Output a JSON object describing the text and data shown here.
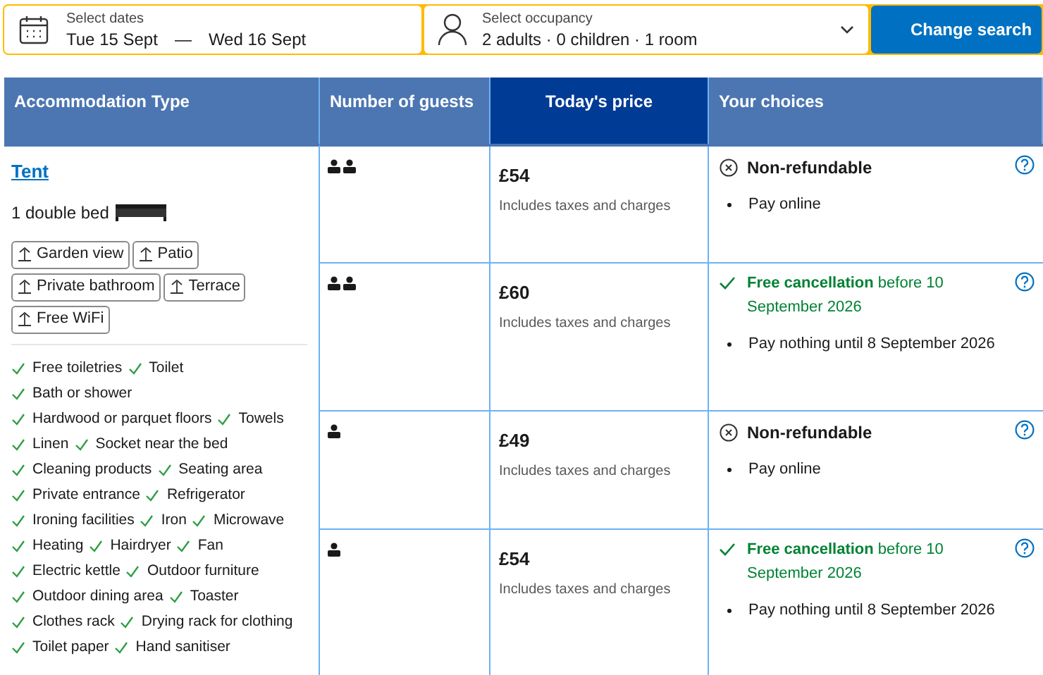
{
  "search_bar": {
    "dates": {
      "label": "Select dates",
      "check_in": "Tue 15 Sept",
      "separator": "—",
      "check_out": "Wed 16 Sept"
    },
    "occupancy": {
      "label": "Select occupancy",
      "value": "2 adults · 0 children · 1 room"
    },
    "button": "Change search"
  },
  "table": {
    "columns": [
      {
        "label": "Accommodation Type",
        "selected": false
      },
      {
        "label": "Number of guests",
        "selected": false
      },
      {
        "label": "Today's price",
        "selected": true
      },
      {
        "label": "Your choices",
        "selected": false
      }
    ],
    "accommodation": {
      "name": "Tent",
      "bed": "1 double bed",
      "facilities": [
        [
          "Garden view",
          "Patio"
        ],
        [
          "Private bathroom",
          "Terrace"
        ],
        [
          "Free WiFi"
        ]
      ],
      "amenity_lines": [
        [
          "Free toiletries",
          "Toilet"
        ],
        [
          "Bath or shower"
        ],
        [
          "Hardwood or parquet floors",
          "Towels"
        ],
        [
          "Linen",
          "Socket near the bed"
        ],
        [
          "Cleaning products",
          "Seating area"
        ],
        [
          "Private entrance",
          "Refrigerator"
        ],
        [
          "Ironing facilities",
          "Iron",
          "Microwave"
        ],
        [
          "Heating",
          "Hairdryer",
          "Fan"
        ],
        [
          "Electric kettle",
          "Outdoor furniture"
        ],
        [
          "Outdoor dining area",
          "Toaster"
        ],
        [
          "Clothes rack",
          "Drying rack for clothing"
        ],
        [
          "Toilet paper",
          "Hand sanitiser"
        ]
      ]
    },
    "rows": [
      {
        "kind": "double",
        "price": "£54",
        "price_note": "Includes taxes and charges",
        "choice": {
          "kind": "non_refundable",
          "title": "Non-refundable",
          "bullet": "Pay online"
        }
      },
      {
        "kind": "double",
        "price": "£60",
        "price_note": "Includes taxes and charges",
        "choice": {
          "kind": "free_cancellation",
          "title": "**Free cancellation** before 10 September 2026",
          "bullet": "Pay nothing until 8 September 2026"
        }
      },
      {
        "kind": "single",
        "price": "£49",
        "price_note": "Includes taxes and charges",
        "choice": {
          "kind": "non_refundable",
          "title": "Non-refundable",
          "bullet": "Pay online"
        }
      },
      {
        "kind": "single",
        "price": "£54",
        "price_note": "Includes taxes and charges",
        "choice": {
          "kind": "free_cancellation",
          "title": "**Free cancellation** before 10 September 2026",
          "bullet": "Pay nothing until 8 September 2026"
        }
      }
    ]
  }
}
